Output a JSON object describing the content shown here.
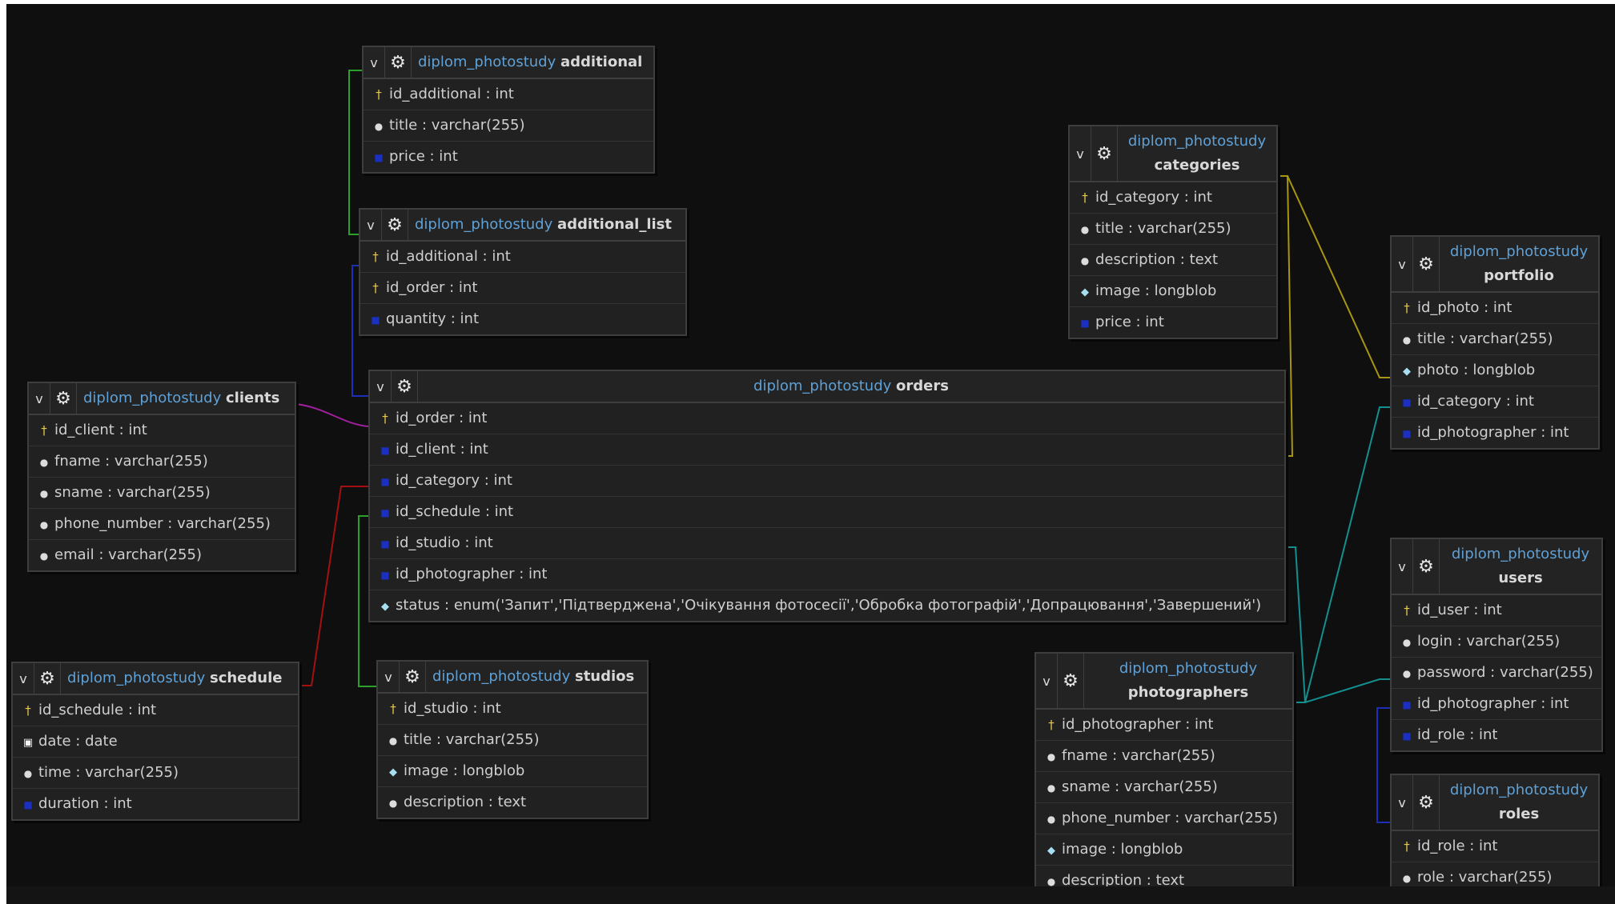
{
  "db_prefix": "diplom_photostudy",
  "header_controls": {
    "collapse": "v",
    "options": "⚙"
  },
  "link_colors": {
    "green": "#2aa12a",
    "blue": "#1d2fb8",
    "magenta": "#a01f9e",
    "red": "#a31010",
    "yellow": "#a89610",
    "teal": "#138f8f"
  },
  "tables": {
    "additional": {
      "name": "additional",
      "columns": [
        {
          "icon": "key",
          "text": "id_additional : int"
        },
        {
          "icon": "col",
          "text": "title : varchar(255)"
        },
        {
          "icon": "fk",
          "text": "price : int"
        }
      ]
    },
    "additional_list": {
      "name": "additional_list",
      "columns": [
        {
          "icon": "key",
          "text": "id_additional : int"
        },
        {
          "icon": "key",
          "text": "id_order : int"
        },
        {
          "icon": "fk",
          "text": "quantity : int"
        }
      ]
    },
    "categories": {
      "name": "categories",
      "columns": [
        {
          "icon": "key",
          "text": "id_category : int"
        },
        {
          "icon": "col",
          "text": "title : varchar(255)"
        },
        {
          "icon": "col",
          "text": "description : text"
        },
        {
          "icon": "blob",
          "text": "image : longblob"
        },
        {
          "icon": "fk",
          "text": "price : int"
        }
      ]
    },
    "portfolio": {
      "name": "portfolio",
      "columns": [
        {
          "icon": "key",
          "text": "id_photo : int"
        },
        {
          "icon": "col",
          "text": "title : varchar(255)"
        },
        {
          "icon": "blob",
          "text": "photo : longblob"
        },
        {
          "icon": "fk",
          "text": "id_category : int"
        },
        {
          "icon": "fk",
          "text": "id_photographer : int"
        }
      ]
    },
    "clients": {
      "name": "clients",
      "columns": [
        {
          "icon": "key",
          "text": "id_client : int"
        },
        {
          "icon": "col",
          "text": "fname : varchar(255)"
        },
        {
          "icon": "col",
          "text": "sname : varchar(255)"
        },
        {
          "icon": "col",
          "text": "phone_number : varchar(255)"
        },
        {
          "icon": "col",
          "text": "email : varchar(255)"
        }
      ]
    },
    "orders": {
      "name": "orders",
      "columns": [
        {
          "icon": "key",
          "text": "id_order : int"
        },
        {
          "icon": "fk",
          "text": "id_client : int"
        },
        {
          "icon": "fk",
          "text": "id_category : int"
        },
        {
          "icon": "fk",
          "text": "id_schedule : int"
        },
        {
          "icon": "fk",
          "text": "id_studio : int"
        },
        {
          "icon": "fk",
          "text": "id_photographer : int"
        },
        {
          "icon": "blob",
          "text": "status : enum('Запит','Підтверджена','Очікування фотосесії','Обробка фотографій','Допрацювання','Завершений')"
        }
      ]
    },
    "users": {
      "name": "users",
      "columns": [
        {
          "icon": "key",
          "text": "id_user : int"
        },
        {
          "icon": "col",
          "text": "login : varchar(255)"
        },
        {
          "icon": "col",
          "text": "password : varchar(255)"
        },
        {
          "icon": "fk",
          "text": "id_photographer : int"
        },
        {
          "icon": "fk",
          "text": "id_role : int"
        }
      ]
    },
    "schedule": {
      "name": "schedule",
      "columns": [
        {
          "icon": "key",
          "text": "id_schedule : int"
        },
        {
          "icon": "date",
          "text": "date : date"
        },
        {
          "icon": "col",
          "text": "time : varchar(255)"
        },
        {
          "icon": "fk",
          "text": "duration : int"
        }
      ]
    },
    "studios": {
      "name": "studios",
      "columns": [
        {
          "icon": "key",
          "text": "id_studio : int"
        },
        {
          "icon": "col",
          "text": "title : varchar(255)"
        },
        {
          "icon": "blob",
          "text": "image : longblob"
        },
        {
          "icon": "col",
          "text": "description : text"
        }
      ]
    },
    "photographers": {
      "name": "photographers",
      "columns": [
        {
          "icon": "key",
          "text": "id_photographer : int"
        },
        {
          "icon": "col",
          "text": "fname : varchar(255)"
        },
        {
          "icon": "col",
          "text": "sname : varchar(255)"
        },
        {
          "icon": "col",
          "text": "phone_number : varchar(255)"
        },
        {
          "icon": "blob",
          "text": "image : longblob"
        },
        {
          "icon": "col",
          "text": "description : text"
        }
      ]
    },
    "roles": {
      "name": "roles",
      "columns": [
        {
          "icon": "key",
          "text": "id_role : int"
        },
        {
          "icon": "col",
          "text": "role : varchar(255)"
        }
      ]
    }
  }
}
